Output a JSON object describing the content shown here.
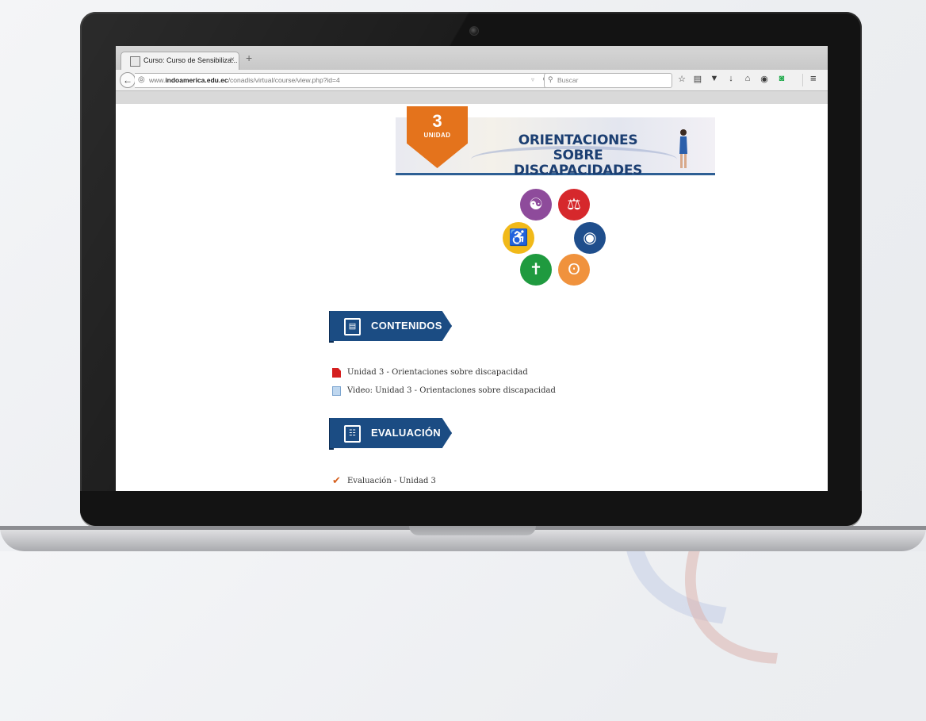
{
  "browser": {
    "tab_title": "Curso: Curso de Sensibiliza...",
    "tab_close": "×",
    "new_tab": "+",
    "url_domain_prefix": "www.",
    "url_domain": "indoamerica.edu.ec",
    "url_path": "/conadis/virtual/course/view.php?id=4",
    "search_placeholder": "Buscar",
    "toolbar_icons": [
      "star-icon",
      "clipboard-icon",
      "pocket-icon",
      "download-icon",
      "home-icon",
      "chat-icon",
      "extension-icon"
    ],
    "menu_icon": "hamburger-menu-icon"
  },
  "banner": {
    "unit_number": "3",
    "unit_label": "UNIDAD",
    "title_line1": "ORIENTACIONES SOBRE",
    "title_line2": "DISCAPACIDADES"
  },
  "disability_icons": [
    {
      "name": "intellectual",
      "color": "#8e4b9b"
    },
    {
      "name": "visual",
      "color": "#d6282c"
    },
    {
      "name": "physical",
      "color": "#f1b919"
    },
    {
      "name": "psychosocial",
      "color": "#1f4e8c"
    },
    {
      "name": "multiple",
      "color": "#1f9a3f"
    },
    {
      "name": "hearing",
      "color": "#f0923d"
    }
  ],
  "sections": [
    {
      "title": "CONTENIDOS",
      "items": [
        {
          "type": "pdf",
          "text": "Unidad 3 - Orientaciones sobre discapacidad"
        },
        {
          "type": "page",
          "text": "Video: Unidad 3 - Orientaciones sobre discapacidad"
        }
      ]
    },
    {
      "title": "EVALUACIÓN",
      "items": [
        {
          "type": "quiz",
          "text": "Evaluación - Unidad 3"
        }
      ]
    }
  ],
  "colors": {
    "section_blue": "#1b4c83",
    "ribbon_orange": "#e4731c",
    "title_blue": "#1c3f72"
  }
}
